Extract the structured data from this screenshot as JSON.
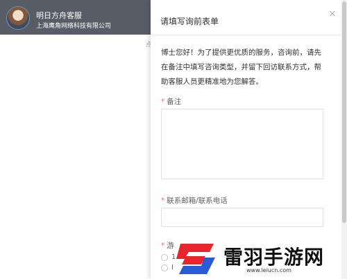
{
  "header": {
    "service_name": "明日方舟客服",
    "company": "上海鹰角网络科技有限公司"
  },
  "chat": {
    "hint_fragment": "点"
  },
  "form": {
    "title": "请填写询前表单",
    "close_label": "×",
    "intro": "博士您好！为了提供更优质的服务，咨询前，请先在备注中填写咨询类型，并留下回访联系方式，帮助客服人员更精准地为您解答。",
    "required_mark": "*",
    "remark_label": "备注",
    "contact_label": "联系邮箱/联系电话",
    "partial_label": "游",
    "option_1_fragment": "1",
    "option_2_fragment": "I"
  },
  "watermark": {
    "title": "雷羽手游网",
    "url": "www.leiucn.com",
    "colors": {
      "red": "#e8252d",
      "blue": "#2a5bd7"
    }
  }
}
